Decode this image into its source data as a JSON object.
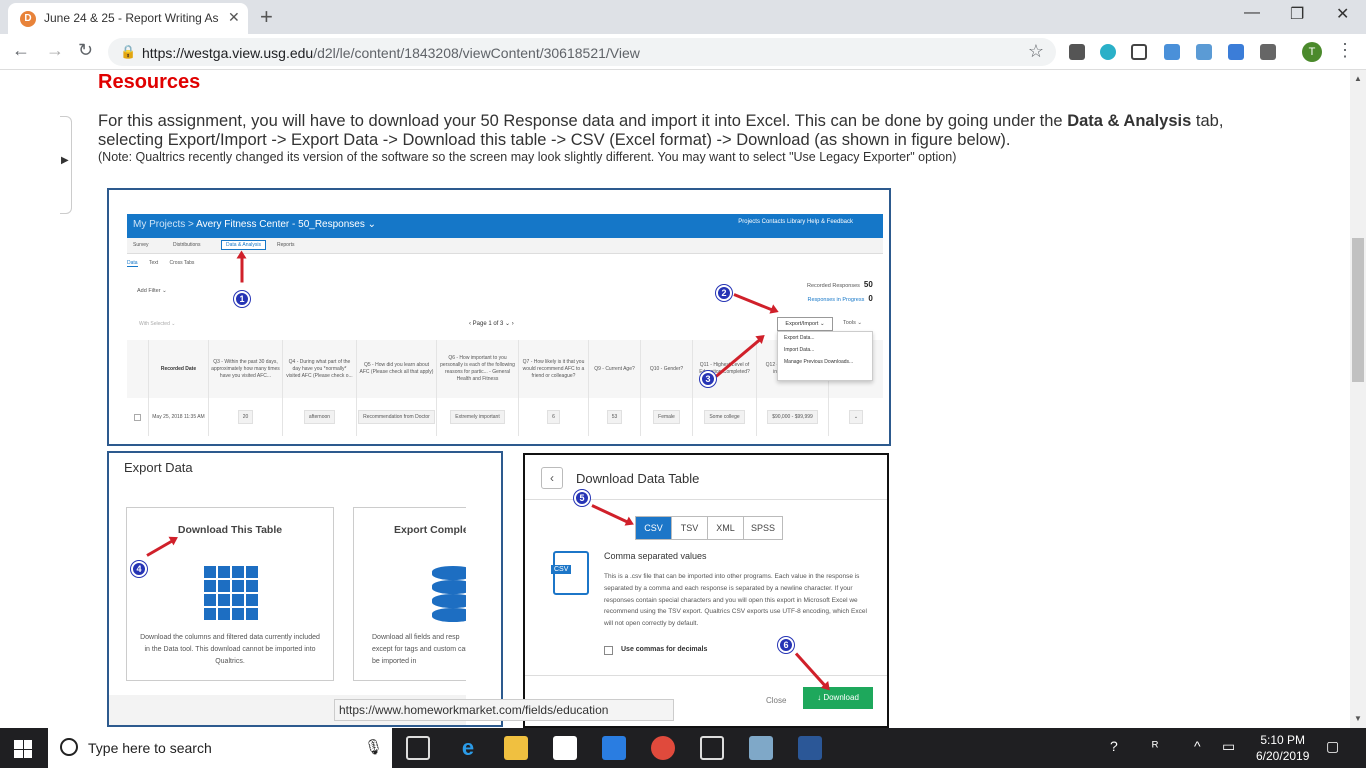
{
  "browser": {
    "tab_title": "June 24 & 25 - Report Writing As",
    "url_host": "https://westga.view.usg.edu",
    "url_path": "/d2l/le/content/1843208/viewContent/30618521/View",
    "profile_initial": "T",
    "tab_favicon": "brand-icon"
  },
  "page": {
    "heading": "Resources",
    "para_prefix": "For this assignment, you will have to download your 50 Response data and import it into Excel. This can be done by going under the ",
    "para_bold": "Data & Analysis",
    "para_suffix": " tab, selecting Export/Import -> Export Data -> Download this table -> CSV (Excel format) -> Download (as shown in figure below).",
    "note": "(Note: Qualtrics recently changed its version of the software so the screen may look slightly different. You may want to select \"Use Legacy Exporter\" option)",
    "hover_url": "https://www.homeworkmarket.com/fields/education"
  },
  "figure1": {
    "crumb_prefix": "My Projects  > ",
    "crumb_project": "Avery Fitness Center - 50_Responses ⌄",
    "top_nav": "Projects   Contacts   Library   Help & Feedback",
    "tabs": [
      "Survey",
      "Distributions",
      "Data & Analysis",
      "Reports"
    ],
    "subtabs": [
      "Data",
      "Text",
      "Cross Tabs"
    ],
    "add_filter": "Add Filter ⌄",
    "recorded_label": "Recorded Responses",
    "recorded_value": "50",
    "inprogress_label": "Responses in Progress",
    "inprogress_value": "0",
    "with_selected": "With Selected ⌄",
    "pager": "‹      Page 1 of 3  ⌄      ›",
    "export_btn": "Export/Import ⌄",
    "tools_btn": "Tools ⌄",
    "menu": [
      "Export Data...",
      "Import Data...",
      "Manage Previous Downloads..."
    ],
    "columns": [
      {
        "head": "",
        "cell": ""
      },
      {
        "head": "Recorded Date",
        "cell": "May 25, 2018 11:35 AM"
      },
      {
        "head": "Q3 - Within the past 30 days, approximately how many times have you visited AFC...",
        "cell": "20"
      },
      {
        "head": "Q4 - During what part of the day have you *normally* visited AFC (Please check o...",
        "cell": "afternoon"
      },
      {
        "head": "Q5 - How did you learn about AFC (Please check all that apply)",
        "cell": "Recommendation from Doctor"
      },
      {
        "head": "Q6 - How important to you personally is each of the following reasons for partic... - General Health and Fitness",
        "cell": "Extremely important"
      },
      {
        "head": "Q7 - How likely is it that you would recommend AFC to a friend or colleague?",
        "cell": "6"
      },
      {
        "head": "Q9 - Current Age?",
        "cell": "53"
      },
      {
        "head": "Q10 - Gender?",
        "cell": "Female"
      },
      {
        "head": "Q11 - Highest Level of Education Completed?",
        "cell": "Some college"
      },
      {
        "head": "Q12 - Annual household income before t...",
        "cell": "$90,000 - $99,999"
      },
      {
        "head": "",
        "cell": "⌄"
      }
    ]
  },
  "figure2": {
    "title": "Export Data",
    "card_a_title": "Download This Table",
    "card_a_desc": "Download the columns and filtered data currently included in the Data tool. This download cannot be imported into Qualtrics.",
    "card_b_title": "Export Comple",
    "card_b_desc": "Download all fields and resp except for tags and custom can be imported in"
  },
  "figure3": {
    "title": "Download Data Table",
    "formats": [
      "CSV",
      "TSV",
      "XML",
      "SPSS"
    ],
    "file_badge": "CSV",
    "format_title": "Comma separated values",
    "format_desc": "This is a .csv file that can be imported into other programs. Each value in the response is separated by a comma and each response is separated by a newline character. If your responses contain special characters and you will open this export in Microsoft Excel we recommend using the TSV export. Qualtrics CSV exports use UTF-8 encoding, which Excel will not open correctly by default.",
    "checkbox_label": "Use commas for decimals",
    "close": "Close",
    "download": "↓  Download"
  },
  "markers": [
    "1",
    "2",
    "3",
    "4",
    "5",
    "6"
  ],
  "taskbar": {
    "search_placeholder": "Type here to search",
    "time": "5:10 PM",
    "date": "6/20/2019"
  }
}
